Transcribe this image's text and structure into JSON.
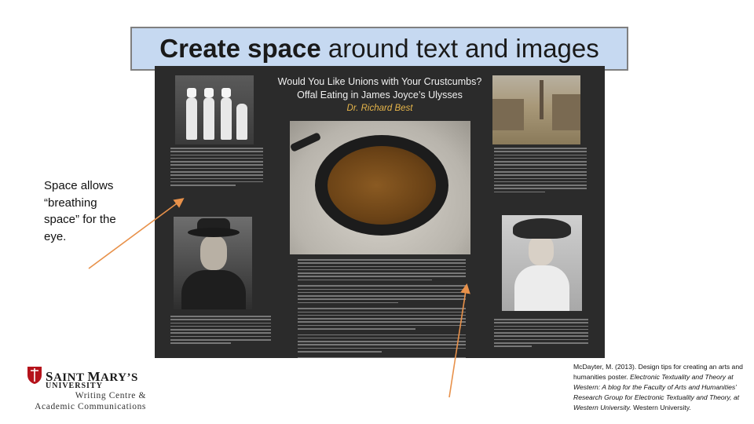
{
  "slide": {
    "title_bold": "Create space",
    "title_rest": " around text and images",
    "note": "Space allows “breathing space” for the eye.",
    "citation_plain_1": "McDayter, M. (2013). Design tips for creating an arts and humanities poster. ",
    "citation_italic": "Electronic Textuality and Theory at Western: A blog for the Faculty of Arts and Humanities’ Research Group for Electronic Textuality and Theory, at Western University.",
    "citation_plain_2": " Western University."
  },
  "poster": {
    "title_line1": "Would You Like Unions with Your Crustcumbs?",
    "title_line2": "Offal Eating in James Joyce’s Ulysses",
    "author": "Dr. Richard Best"
  },
  "logo": {
    "name_initial_s": "S",
    "name_rest_1": "AINT ",
    "name_initial_m": "M",
    "name_rest_2": "ARY’S",
    "university": "UNIVERSITY",
    "line1": "Writing Centre &",
    "line2": "Academic Communications",
    "shield_color": "#b5121b"
  },
  "colors": {
    "title_fill": "#c6d9f1",
    "arrow": "#e8914a",
    "poster_bg": "#2b2b2b",
    "author_accent": "#e6b54a"
  }
}
